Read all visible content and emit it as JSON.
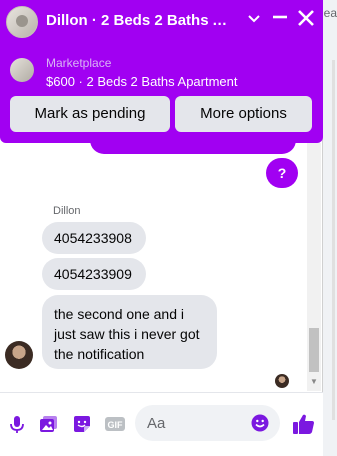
{
  "background_page": {
    "peek_text": "ea"
  },
  "chat": {
    "title": "Dillon · 2 Beds 2 Baths Ap...",
    "accent_color": "#a100f2",
    "header_icons": [
      "chevron-down-icon",
      "minimize-icon",
      "close-icon"
    ],
    "marketplace": {
      "label": "Marketplace",
      "item": "$600 · 2 Beds 2 Baths Apartment"
    },
    "actions": {
      "mark_pending": "Mark as pending",
      "more_options": "More options"
    },
    "messages": {
      "sent_last": "?",
      "sender_name": "Dillon",
      "received": [
        "4054233908",
        "4054233909",
        "the second one and i just saw this i never got the notification"
      ]
    },
    "composer": {
      "placeholder": "Aa",
      "icons": [
        "mic-icon",
        "photo-icon",
        "sticker-icon",
        "gif-icon",
        "emoji-icon",
        "thumbs-up-icon"
      ],
      "gif_label": "GIF"
    }
  }
}
